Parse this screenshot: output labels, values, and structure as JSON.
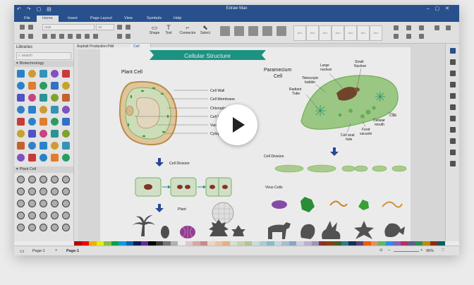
{
  "app": {
    "title": "Edraw Max"
  },
  "menu": [
    {
      "label": "File"
    },
    {
      "label": "Home"
    },
    {
      "label": "Insert"
    },
    {
      "label": "Page Layout"
    },
    {
      "label": "View"
    },
    {
      "label": "Symbols"
    },
    {
      "label": "Help"
    }
  ],
  "ribbon": {
    "font_name": "Arial",
    "font_size": "10",
    "tools": [
      {
        "label": "Shape"
      },
      {
        "label": "Text"
      },
      {
        "label": "Connector"
      },
      {
        "label": "Select"
      }
    ],
    "style_label": "Abc"
  },
  "tabs": [
    {
      "label": "Asphalt Production.Pdd"
    },
    {
      "label": "Cell"
    }
  ],
  "library": {
    "title": "Libraries",
    "search_placeholder": "search",
    "categories": [
      {
        "label": "Biotechnology"
      },
      {
        "label": "Plant Cell"
      }
    ]
  },
  "diagram": {
    "banner": "Cellular Structure",
    "plant_cell_title": "Plant Cell",
    "plant_labels": [
      "Cell Wall",
      "Cell Membrane",
      "Chloroplast",
      "Cell Nucleus",
      "Vacuole",
      "Cytoplasm"
    ],
    "cell_division": "Cell Division",
    "plant": "Plant",
    "paramecium_title_1": "Paramecium",
    "paramecium_title_2": "Cell",
    "para_labels": {
      "large_nuclear_1": "Large",
      "large_nuclear_2": "nuclear",
      "small_nuclear_1": "Small",
      "small_nuclear_2": "Nuclear",
      "telescopic_1": "Telescopic",
      "telescopic_2": "bubble",
      "radiant_1": "Radiant",
      "radiant_2": "Tube",
      "cilia": "Cilia",
      "cellular_mouth_1": "Cellular",
      "cellular_mouth_2": "mouth",
      "food_vacuole_1": "Food",
      "food_vacuole_2": "vacuole",
      "cell_anal_1": "Cell anal",
      "cell_anal_2": "hole"
    },
    "cell_division_right": "Cell Division",
    "virus_cells": "Virus Cells"
  },
  "status": {
    "page_select": "Page-1",
    "page_tab": "Page-1",
    "zoom": "95%"
  },
  "colors": {
    "accent": "#2b579a",
    "banner": "#1f9f8f",
    "plant_cell_fill": "#f3d6a8",
    "cytoplasm": "#dff0c9",
    "paramecium": "#a8d890"
  },
  "icons": [
    "play-icon",
    "search-icon",
    "close-icon",
    "minimize-icon",
    "maximize-icon"
  ]
}
